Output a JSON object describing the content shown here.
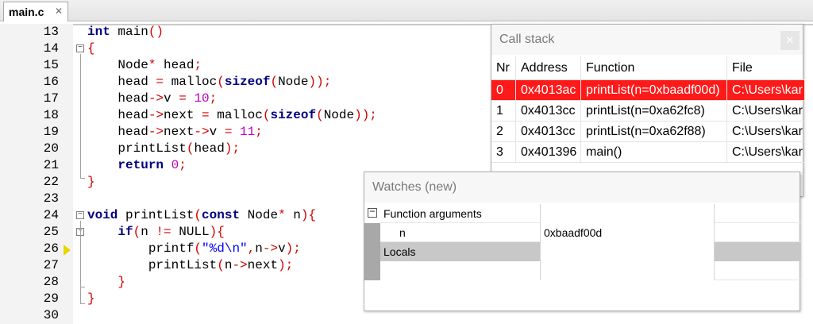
{
  "tab": {
    "label": "main.c",
    "close": "✕"
  },
  "editor": {
    "lines": [
      {
        "n": "13",
        "tokens": [
          [
            "kw",
            "int"
          ],
          [
            "p",
            " main"
          ],
          [
            "op",
            "()"
          ]
        ]
      },
      {
        "n": "14",
        "tokens": [
          [
            "op",
            "{"
          ]
        ]
      },
      {
        "n": "15",
        "tokens": [
          [
            "p",
            "    Node"
          ],
          [
            "op",
            "*"
          ],
          [
            "p",
            " head"
          ],
          [
            "op",
            ";"
          ]
        ]
      },
      {
        "n": "16",
        "tokens": [
          [
            "p",
            "    head "
          ],
          [
            "op",
            "="
          ],
          [
            "p",
            " malloc"
          ],
          [
            "op",
            "("
          ],
          [
            "kw",
            "sizeof"
          ],
          [
            "op",
            "("
          ],
          [
            "p",
            "Node"
          ],
          [
            "op",
            "));"
          ]
        ]
      },
      {
        "n": "17",
        "tokens": [
          [
            "p",
            "    head"
          ],
          [
            "op",
            "->"
          ],
          [
            "p",
            "v "
          ],
          [
            "op",
            "="
          ],
          [
            "p",
            " "
          ],
          [
            "num",
            "10"
          ],
          [
            "op",
            ";"
          ]
        ]
      },
      {
        "n": "18",
        "tokens": [
          [
            "p",
            "    head"
          ],
          [
            "op",
            "->"
          ],
          [
            "p",
            "next "
          ],
          [
            "op",
            "="
          ],
          [
            "p",
            " malloc"
          ],
          [
            "op",
            "("
          ],
          [
            "kw",
            "sizeof"
          ],
          [
            "op",
            "("
          ],
          [
            "p",
            "Node"
          ],
          [
            "op",
            "));"
          ]
        ]
      },
      {
        "n": "19",
        "tokens": [
          [
            "p",
            "    head"
          ],
          [
            "op",
            "->"
          ],
          [
            "p",
            "next"
          ],
          [
            "op",
            "->"
          ],
          [
            "p",
            "v "
          ],
          [
            "op",
            "="
          ],
          [
            "p",
            " "
          ],
          [
            "num",
            "11"
          ],
          [
            "op",
            ";"
          ]
        ]
      },
      {
        "n": "20",
        "tokens": [
          [
            "p",
            "    printList"
          ],
          [
            "op",
            "("
          ],
          [
            "p",
            "head"
          ],
          [
            "op",
            ");"
          ]
        ]
      },
      {
        "n": "21",
        "tokens": [
          [
            "p",
            "    "
          ],
          [
            "kw",
            "return"
          ],
          [
            "p",
            " "
          ],
          [
            "num",
            "0"
          ],
          [
            "op",
            ";"
          ]
        ]
      },
      {
        "n": "22",
        "tokens": [
          [
            "op",
            "}"
          ]
        ]
      },
      {
        "n": "23",
        "tokens": []
      },
      {
        "n": "24",
        "tokens": [
          [
            "kw",
            "void"
          ],
          [
            "p",
            " printList"
          ],
          [
            "op",
            "("
          ],
          [
            "kw",
            "const"
          ],
          [
            "p",
            " Node"
          ],
          [
            "op",
            "*"
          ],
          [
            "p",
            " n"
          ],
          [
            "op",
            ")"
          ],
          [
            "op",
            "{"
          ]
        ]
      },
      {
        "n": "25",
        "tokens": [
          [
            "p",
            "    "
          ],
          [
            "kw",
            "if"
          ],
          [
            "op",
            "("
          ],
          [
            "p",
            "n "
          ],
          [
            "op",
            "!="
          ],
          [
            "p",
            " NULL"
          ],
          [
            "op",
            ")"
          ],
          [
            "op",
            "{"
          ]
        ]
      },
      {
        "n": "26",
        "tokens": [
          [
            "p",
            "        printf"
          ],
          [
            "op",
            "("
          ],
          [
            "str",
            "\"%d\\n\""
          ],
          [
            "op",
            ","
          ],
          [
            "p",
            "n"
          ],
          [
            "op",
            "->"
          ],
          [
            "p",
            "v"
          ],
          [
            "op",
            ");"
          ]
        ]
      },
      {
        "n": "27",
        "tokens": [
          [
            "p",
            "        printList"
          ],
          [
            "op",
            "("
          ],
          [
            "p",
            "n"
          ],
          [
            "op",
            "->"
          ],
          [
            "p",
            "next"
          ],
          [
            "op",
            ");"
          ]
        ]
      },
      {
        "n": "28",
        "tokens": [
          [
            "p",
            "    "
          ],
          [
            "op",
            "}"
          ]
        ]
      },
      {
        "n": "29",
        "tokens": [
          [
            "op",
            "}"
          ]
        ]
      },
      {
        "n": "30",
        "tokens": []
      }
    ]
  },
  "callstack": {
    "title": "Call stack",
    "close": "✕",
    "headers": {
      "nr": "Nr",
      "address": "Address",
      "function": "Function",
      "file": "File"
    },
    "rows": [
      {
        "nr": "0",
        "address": "0x4013ac",
        "function": "printList(n=0xbaadf00d)",
        "file": "C:\\Users\\kar",
        "selected": true
      },
      {
        "nr": "1",
        "address": "0x4013cc",
        "function": "printList(n=0xa62fc8)",
        "file": "C:\\Users\\kar",
        "selected": false
      },
      {
        "nr": "2",
        "address": "0x4013cc",
        "function": "printList(n=0xa62f88)",
        "file": "C:\\Users\\kar",
        "selected": false
      },
      {
        "nr": "3",
        "address": "0x401396",
        "function": "main()",
        "file": "C:\\Users\\kar",
        "selected": false
      }
    ],
    "scroll_left": "‹",
    "scroll_right": "›"
  },
  "watches": {
    "title": "Watches (new)",
    "rows": [
      {
        "label": "Function arguments",
        "value": "",
        "toggle": "−"
      },
      {
        "label": "n",
        "value": "0xbaadf00d"
      },
      {
        "label": "Locals",
        "value": ""
      },
      {
        "label": "",
        "value": ""
      }
    ]
  },
  "colors": {
    "selected_row": "#ff1a1a",
    "keyword": "#000080",
    "operator": "#d00000",
    "number": "#c000c0",
    "string": "#0000ff"
  }
}
